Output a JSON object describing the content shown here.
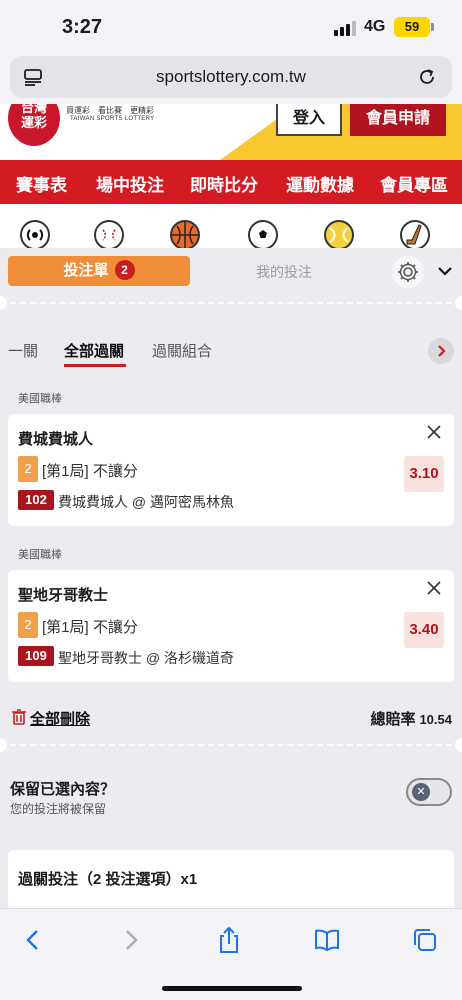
{
  "status_bar": {
    "time": "3:27",
    "network": "4G",
    "battery": "59"
  },
  "browser": {
    "url": "sportslottery.com.tw"
  },
  "header": {
    "logo_text": "台灣\n運彩",
    "logo_tagline": "買運彩　看比賽　更精彩",
    "logo_english": "TAIWAN SPORTS LOTTERY",
    "login_label": "登入",
    "signup_label": "會員申請"
  },
  "nav": {
    "items": [
      "賽事表",
      "場中投注",
      "即時比分",
      "運動數據",
      "會員專區"
    ]
  },
  "sports": [
    "live-icon",
    "baseball-icon",
    "basketball-icon",
    "soccer-icon",
    "tennis-icon",
    "hockey-icon"
  ],
  "slip": {
    "tab_label": "投注單",
    "tab_count": "2",
    "my_bets_label": "我的投注",
    "parlay_tabs": [
      "一關",
      "全部過關",
      "過關組合"
    ],
    "bets": [
      {
        "league": "美國職棒",
        "team": "費城費城人",
        "pick_num": "2",
        "pick": "[第1局] 不讓分",
        "game_num": "102",
        "matchup": "費城費城人 @ 邁阿密馬林魚",
        "odds": "3.10"
      },
      {
        "league": "美國職棒",
        "team": "聖地牙哥教士",
        "pick_num": "2",
        "pick": "[第1局] 不讓分",
        "game_num": "109",
        "matchup": "聖地牙哥教士 @ 洛杉磯道奇",
        "odds": "3.40"
      }
    ],
    "delete_all_label": "全部刪除",
    "total_odds_label": "總賠率",
    "total_odds_value": "10.54",
    "keep_title": "保留已選內容？",
    "keep_subtitle": "您的投注將被保留",
    "keep_toggle_on": false,
    "parlay_summary": "過關投注（2 投注選項）x1"
  },
  "colors": {
    "accent_orange": "#f08d38",
    "brand_red": "#d41b24",
    "odds_red": "#b1141f"
  }
}
